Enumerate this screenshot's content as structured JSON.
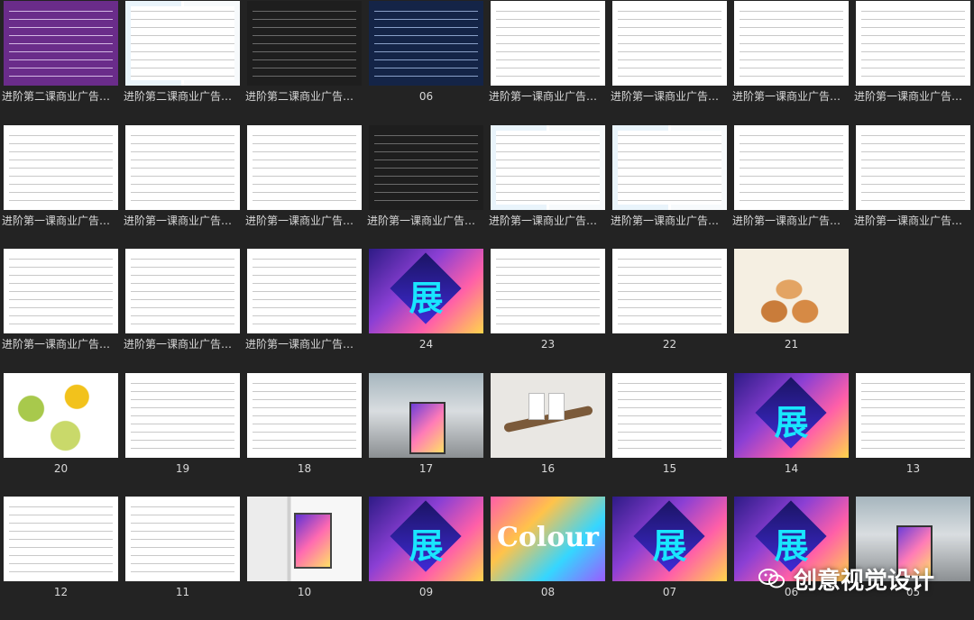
{
  "thumbnails": [
    {
      "label": "进阶第二课商业广告…",
      "style": "purple-doc"
    },
    {
      "label": "进阶第二课商业广告…",
      "style": "split-doc"
    },
    {
      "label": "进阶第二课商业广告…",
      "style": "dark-doc"
    },
    {
      "label": "06",
      "style": "navy-doc"
    },
    {
      "label": "进阶第一课商业广告…",
      "style": "doc"
    },
    {
      "label": "进阶第一课商业广告…",
      "style": "doc"
    },
    {
      "label": "进阶第一课商业广告…",
      "style": "doc"
    },
    {
      "label": "进阶第一课商业广告…",
      "style": "doc"
    },
    {
      "label": "进阶第一课商业广告…",
      "style": "doc"
    },
    {
      "label": "进阶第一课商业广告…",
      "style": "doc"
    },
    {
      "label": "进阶第一课商业广告…",
      "style": "doc"
    },
    {
      "label": "进阶第一课商业广告…",
      "style": "dark-doc"
    },
    {
      "label": "进阶第一课商业广告…",
      "style": "split-doc"
    },
    {
      "label": "进阶第一课商业广告…",
      "style": "split-doc"
    },
    {
      "label": "进阶第一课商业广告…",
      "style": "doc"
    },
    {
      "label": "进阶第一课商业广告…",
      "style": "doc"
    },
    {
      "label": "进阶第一课商业广告…",
      "style": "doc"
    },
    {
      "label": "进阶第一课商业广告…",
      "style": "doc"
    },
    {
      "label": "进阶第一课商业广告…",
      "style": "doc"
    },
    {
      "label": "24",
      "style": "poster",
      "glyph": "展"
    },
    {
      "label": "23",
      "style": "doc"
    },
    {
      "label": "22",
      "style": "doc"
    },
    {
      "label": "21",
      "style": "eggs"
    },
    {
      "label": "",
      "style": "doc",
      "hidden": true
    },
    {
      "label": "20",
      "style": "leaves"
    },
    {
      "label": "19",
      "style": "doc"
    },
    {
      "label": "18",
      "style": "doc"
    },
    {
      "label": "17",
      "style": "photo"
    },
    {
      "label": "16",
      "style": "craft"
    },
    {
      "label": "15",
      "style": "doc"
    },
    {
      "label": "14",
      "style": "poster",
      "glyph": "展"
    },
    {
      "label": "13",
      "style": "doc"
    },
    {
      "label": "12",
      "style": "doc"
    },
    {
      "label": "11",
      "style": "doc"
    },
    {
      "label": "10",
      "style": "interior"
    },
    {
      "label": "09",
      "style": "poster",
      "glyph": "展"
    },
    {
      "label": "08",
      "style": "colour",
      "word": "Colour"
    },
    {
      "label": "07",
      "style": "poster",
      "glyph": "展"
    },
    {
      "label": "06",
      "style": "poster",
      "glyph": "展"
    },
    {
      "label": "05",
      "style": "photo"
    }
  ],
  "watermark": {
    "text": "创意视觉设计",
    "icon": "wechat-icon"
  }
}
